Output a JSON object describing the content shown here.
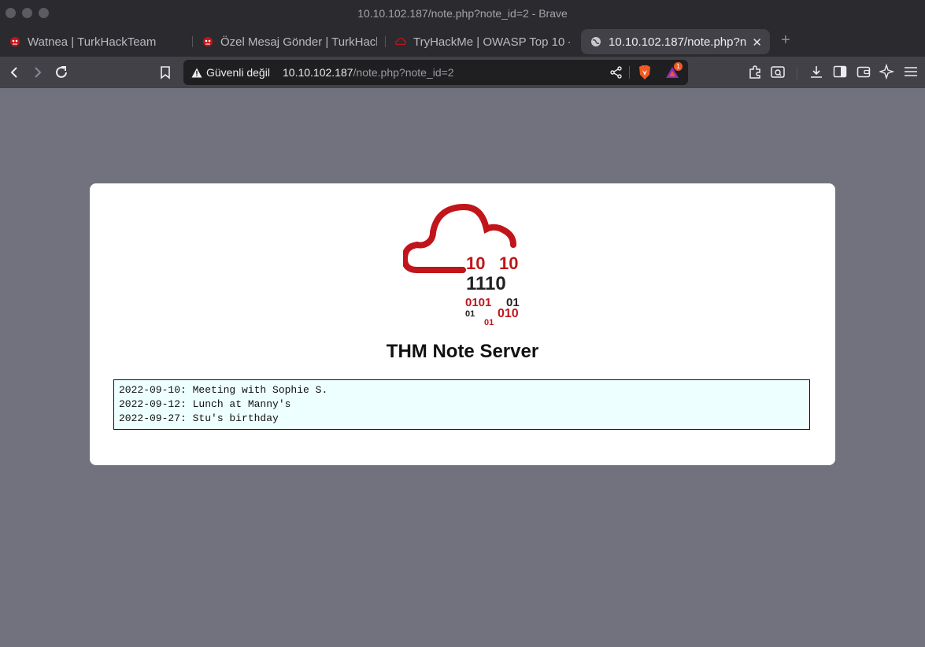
{
  "window": {
    "title": "10.10.102.187/note.php?note_id=2 - Brave"
  },
  "tabs": [
    {
      "label": "Watnea | TurkHackTeam",
      "active": false,
      "icon": "turkhackteam-favicon"
    },
    {
      "label": "Özel Mesaj Gönder | TurkHack",
      "active": false,
      "icon": "turkhackteam-favicon"
    },
    {
      "label": "TryHackMe | OWASP Top 10 -",
      "active": false,
      "icon": "tryhackme-favicon"
    },
    {
      "label": "10.10.102.187/note.php?n",
      "active": true,
      "icon": "globe-icon"
    }
  ],
  "toolbar": {
    "security_label": "Güvenli değil",
    "url_host": "10.10.102.187",
    "url_path": "/note.php?note_id=2",
    "rewards_badge": "1"
  },
  "page": {
    "logo_text": {
      "row1_left": "10",
      "row1_right": "10",
      "row2": "1110",
      "row3_left": "0101",
      "row3_right": "01",
      "row4_left": "01",
      "row4_right": "010",
      "row5": "01"
    },
    "title": "THM Note Server",
    "notes": [
      "2022-09-10: Meeting with Sophie S.",
      "2022-09-12: Lunch at Manny's",
      "2022-09-27: Stu's birthday"
    ]
  },
  "colors": {
    "page_background": "#72727e",
    "accent_red": "#c0151b",
    "notes_background": "#eeffff"
  }
}
